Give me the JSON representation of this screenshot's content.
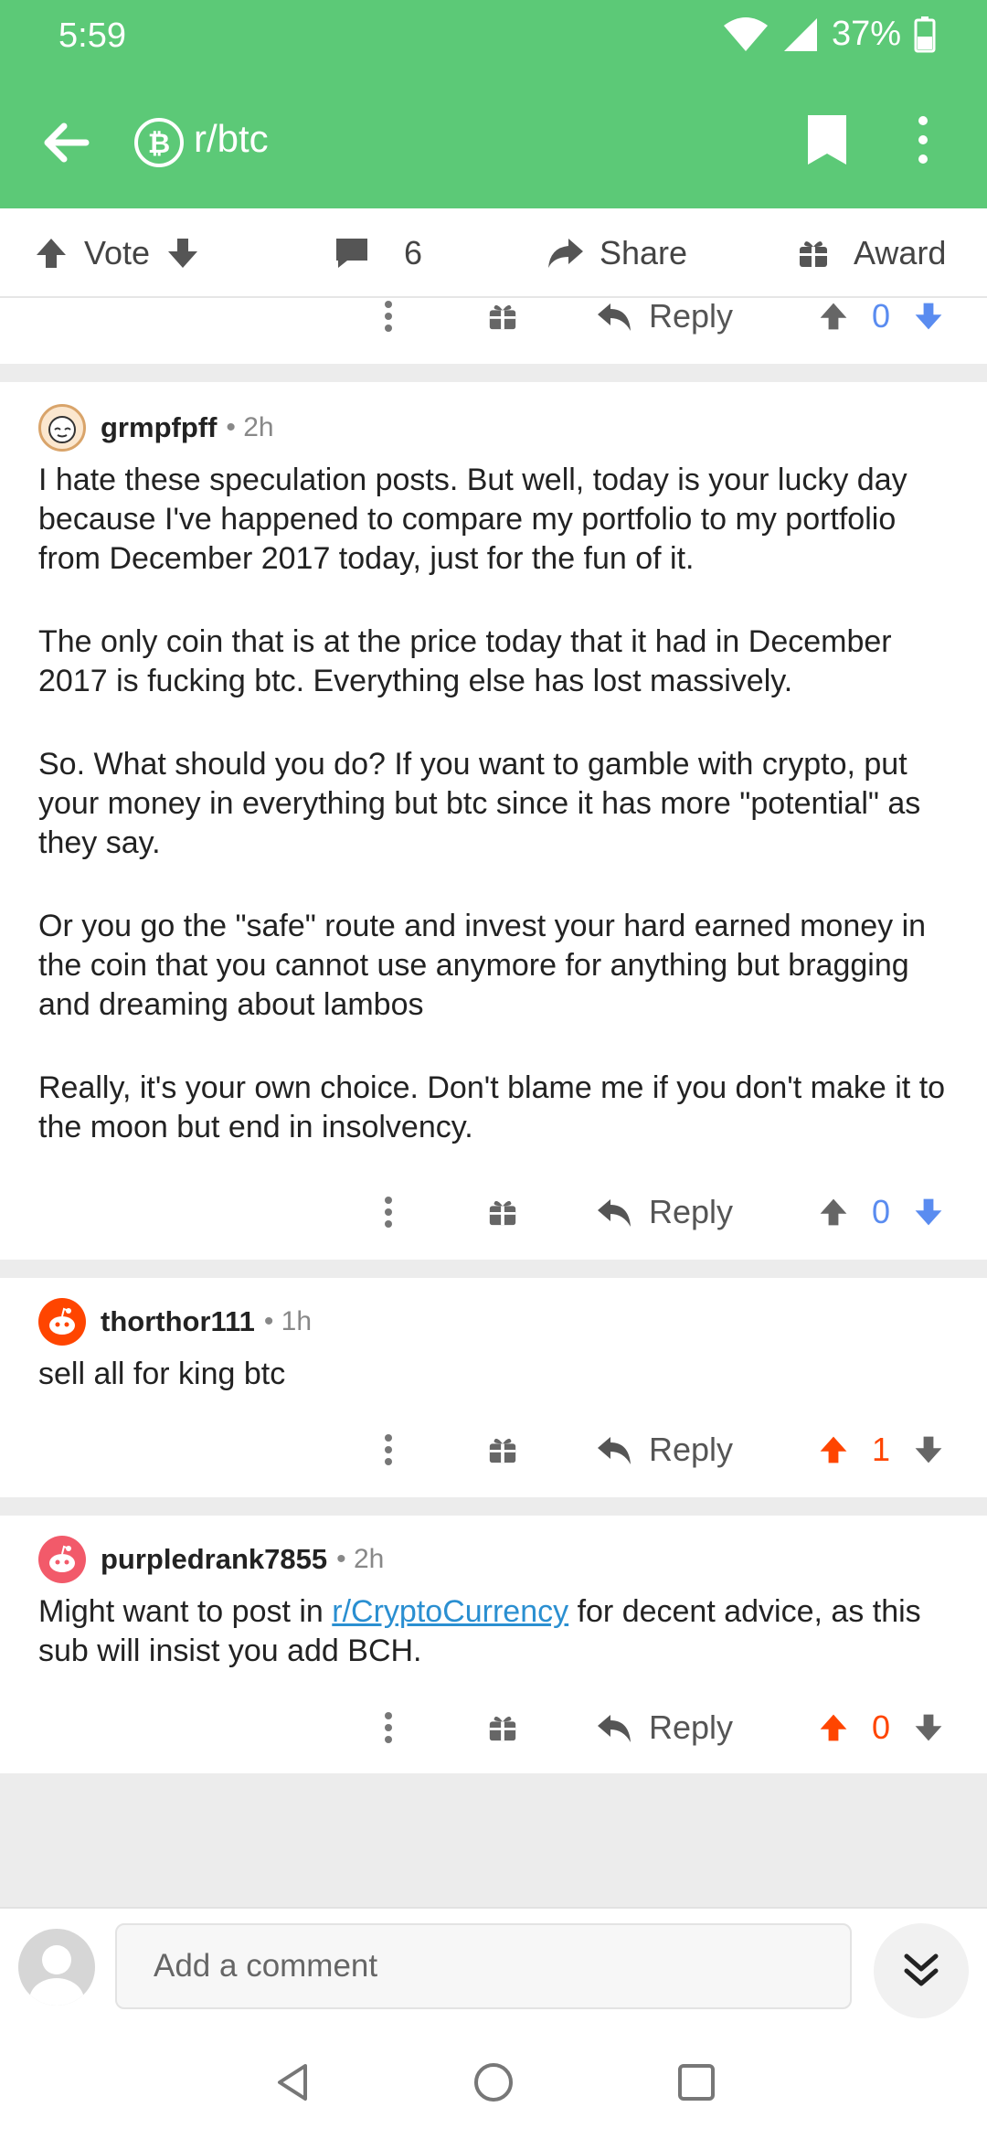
{
  "status": {
    "time": "5:59",
    "battery": "37%"
  },
  "header": {
    "subreddit": "r/btc"
  },
  "post_actions": {
    "vote": "Vote",
    "comments": "6",
    "share": "Share",
    "award": "Award"
  },
  "reply_label": "Reply",
  "top_partial": {
    "score": "0"
  },
  "comments": [
    {
      "author": "grmpfpff",
      "age": "2h",
      "paragraphs": [
        "I hate these speculation posts. But well, today is your lucky day because I've happened to compare my portfolio to my portfolio from December 2017 today, just for the fun of it.",
        "The only coin that is at the price today that it had in December 2017 is fucking btc. Everything else has lost massively.",
        "So. What should you do? If you want to gamble with crypto, put your money in everything but btc since it has more \"potential\" as they say.",
        "Or you go the \"safe\" route and invest your hard earned money in the coin that you cannot use anymore for anything but bragging and dreaming about lambos",
        "Really, it's your own choice. Don't blame me if you don't make it to the moon but end in insolvency."
      ],
      "score": "0",
      "vote_state": "none"
    },
    {
      "author": "thorthor111",
      "age": "1h",
      "text": "sell all for king btc",
      "score": "1",
      "vote_state": "upvoted"
    },
    {
      "author": "purpledrank7855",
      "age": "2h",
      "text_before": "Might want to post in ",
      "link": "r/CryptoCurrency",
      "text_after": " for decent advice, as this sub will insist you add BCH.",
      "score": "0",
      "vote_state": "upvoted"
    }
  ],
  "composer": {
    "placeholder": "Add a comment"
  },
  "colors": {
    "appbar": "#5cc977",
    "upvote": "#ff4500",
    "blue_vote": "#5a8cf0",
    "link": "#2a8fd1"
  },
  "icons": [
    "back-icon",
    "bitcoin-icon",
    "bookmark-icon",
    "more-vertical-icon",
    "upvote-icon",
    "downvote-icon",
    "comment-icon",
    "share-icon",
    "gift-icon",
    "reply-icon",
    "chevron-double-down-icon",
    "avatar-icon"
  ]
}
